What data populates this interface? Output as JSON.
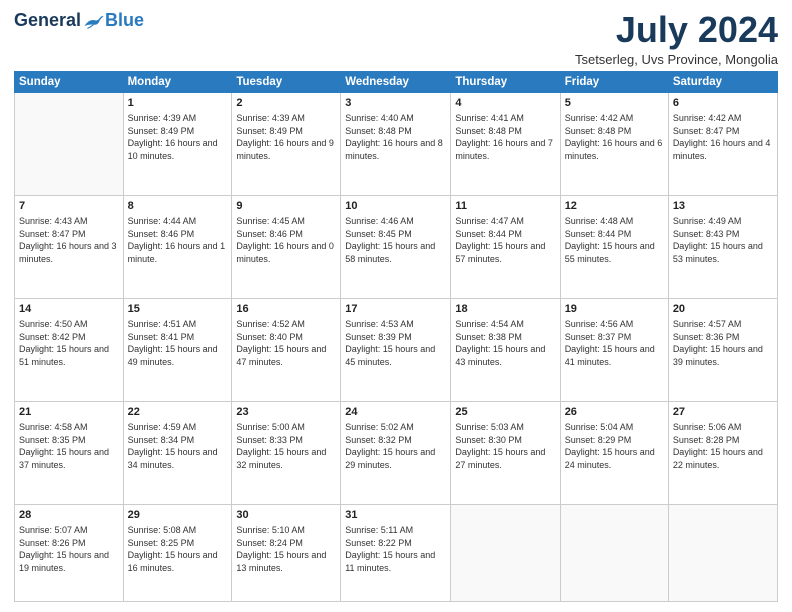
{
  "logo": {
    "general": "General",
    "blue": "Blue"
  },
  "title": "July 2024",
  "location": "Tsetserleg, Uvs Province, Mongolia",
  "header_days": [
    "Sunday",
    "Monday",
    "Tuesday",
    "Wednesday",
    "Thursday",
    "Friday",
    "Saturday"
  ],
  "weeks": [
    [
      {
        "day": "",
        "sunrise": "",
        "sunset": "",
        "daylight": ""
      },
      {
        "day": "1",
        "sunrise": "Sunrise: 4:39 AM",
        "sunset": "Sunset: 8:49 PM",
        "daylight": "Daylight: 16 hours and 10 minutes."
      },
      {
        "day": "2",
        "sunrise": "Sunrise: 4:39 AM",
        "sunset": "Sunset: 8:49 PM",
        "daylight": "Daylight: 16 hours and 9 minutes."
      },
      {
        "day": "3",
        "sunrise": "Sunrise: 4:40 AM",
        "sunset": "Sunset: 8:48 PM",
        "daylight": "Daylight: 16 hours and 8 minutes."
      },
      {
        "day": "4",
        "sunrise": "Sunrise: 4:41 AM",
        "sunset": "Sunset: 8:48 PM",
        "daylight": "Daylight: 16 hours and 7 minutes."
      },
      {
        "day": "5",
        "sunrise": "Sunrise: 4:42 AM",
        "sunset": "Sunset: 8:48 PM",
        "daylight": "Daylight: 16 hours and 6 minutes."
      },
      {
        "day": "6",
        "sunrise": "Sunrise: 4:42 AM",
        "sunset": "Sunset: 8:47 PM",
        "daylight": "Daylight: 16 hours and 4 minutes."
      }
    ],
    [
      {
        "day": "7",
        "sunrise": "Sunrise: 4:43 AM",
        "sunset": "Sunset: 8:47 PM",
        "daylight": "Daylight: 16 hours and 3 minutes."
      },
      {
        "day": "8",
        "sunrise": "Sunrise: 4:44 AM",
        "sunset": "Sunset: 8:46 PM",
        "daylight": "Daylight: 16 hours and 1 minute."
      },
      {
        "day": "9",
        "sunrise": "Sunrise: 4:45 AM",
        "sunset": "Sunset: 8:46 PM",
        "daylight": "Daylight: 16 hours and 0 minutes."
      },
      {
        "day": "10",
        "sunrise": "Sunrise: 4:46 AM",
        "sunset": "Sunset: 8:45 PM",
        "daylight": "Daylight: 15 hours and 58 minutes."
      },
      {
        "day": "11",
        "sunrise": "Sunrise: 4:47 AM",
        "sunset": "Sunset: 8:44 PM",
        "daylight": "Daylight: 15 hours and 57 minutes."
      },
      {
        "day": "12",
        "sunrise": "Sunrise: 4:48 AM",
        "sunset": "Sunset: 8:44 PM",
        "daylight": "Daylight: 15 hours and 55 minutes."
      },
      {
        "day": "13",
        "sunrise": "Sunrise: 4:49 AM",
        "sunset": "Sunset: 8:43 PM",
        "daylight": "Daylight: 15 hours and 53 minutes."
      }
    ],
    [
      {
        "day": "14",
        "sunrise": "Sunrise: 4:50 AM",
        "sunset": "Sunset: 8:42 PM",
        "daylight": "Daylight: 15 hours and 51 minutes."
      },
      {
        "day": "15",
        "sunrise": "Sunrise: 4:51 AM",
        "sunset": "Sunset: 8:41 PM",
        "daylight": "Daylight: 15 hours and 49 minutes."
      },
      {
        "day": "16",
        "sunrise": "Sunrise: 4:52 AM",
        "sunset": "Sunset: 8:40 PM",
        "daylight": "Daylight: 15 hours and 47 minutes."
      },
      {
        "day": "17",
        "sunrise": "Sunrise: 4:53 AM",
        "sunset": "Sunset: 8:39 PM",
        "daylight": "Daylight: 15 hours and 45 minutes."
      },
      {
        "day": "18",
        "sunrise": "Sunrise: 4:54 AM",
        "sunset": "Sunset: 8:38 PM",
        "daylight": "Daylight: 15 hours and 43 minutes."
      },
      {
        "day": "19",
        "sunrise": "Sunrise: 4:56 AM",
        "sunset": "Sunset: 8:37 PM",
        "daylight": "Daylight: 15 hours and 41 minutes."
      },
      {
        "day": "20",
        "sunrise": "Sunrise: 4:57 AM",
        "sunset": "Sunset: 8:36 PM",
        "daylight": "Daylight: 15 hours and 39 minutes."
      }
    ],
    [
      {
        "day": "21",
        "sunrise": "Sunrise: 4:58 AM",
        "sunset": "Sunset: 8:35 PM",
        "daylight": "Daylight: 15 hours and 37 minutes."
      },
      {
        "day": "22",
        "sunrise": "Sunrise: 4:59 AM",
        "sunset": "Sunset: 8:34 PM",
        "daylight": "Daylight: 15 hours and 34 minutes."
      },
      {
        "day": "23",
        "sunrise": "Sunrise: 5:00 AM",
        "sunset": "Sunset: 8:33 PM",
        "daylight": "Daylight: 15 hours and 32 minutes."
      },
      {
        "day": "24",
        "sunrise": "Sunrise: 5:02 AM",
        "sunset": "Sunset: 8:32 PM",
        "daylight": "Daylight: 15 hours and 29 minutes."
      },
      {
        "day": "25",
        "sunrise": "Sunrise: 5:03 AM",
        "sunset": "Sunset: 8:30 PM",
        "daylight": "Daylight: 15 hours and 27 minutes."
      },
      {
        "day": "26",
        "sunrise": "Sunrise: 5:04 AM",
        "sunset": "Sunset: 8:29 PM",
        "daylight": "Daylight: 15 hours and 24 minutes."
      },
      {
        "day": "27",
        "sunrise": "Sunrise: 5:06 AM",
        "sunset": "Sunset: 8:28 PM",
        "daylight": "Daylight: 15 hours and 22 minutes."
      }
    ],
    [
      {
        "day": "28",
        "sunrise": "Sunrise: 5:07 AM",
        "sunset": "Sunset: 8:26 PM",
        "daylight": "Daylight: 15 hours and 19 minutes."
      },
      {
        "day": "29",
        "sunrise": "Sunrise: 5:08 AM",
        "sunset": "Sunset: 8:25 PM",
        "daylight": "Daylight: 15 hours and 16 minutes."
      },
      {
        "day": "30",
        "sunrise": "Sunrise: 5:10 AM",
        "sunset": "Sunset: 8:24 PM",
        "daylight": "Daylight: 15 hours and 13 minutes."
      },
      {
        "day": "31",
        "sunrise": "Sunrise: 5:11 AM",
        "sunset": "Sunset: 8:22 PM",
        "daylight": "Daylight: 15 hours and 11 minutes."
      },
      {
        "day": "",
        "sunrise": "",
        "sunset": "",
        "daylight": ""
      },
      {
        "day": "",
        "sunrise": "",
        "sunset": "",
        "daylight": ""
      },
      {
        "day": "",
        "sunrise": "",
        "sunset": "",
        "daylight": ""
      }
    ]
  ]
}
